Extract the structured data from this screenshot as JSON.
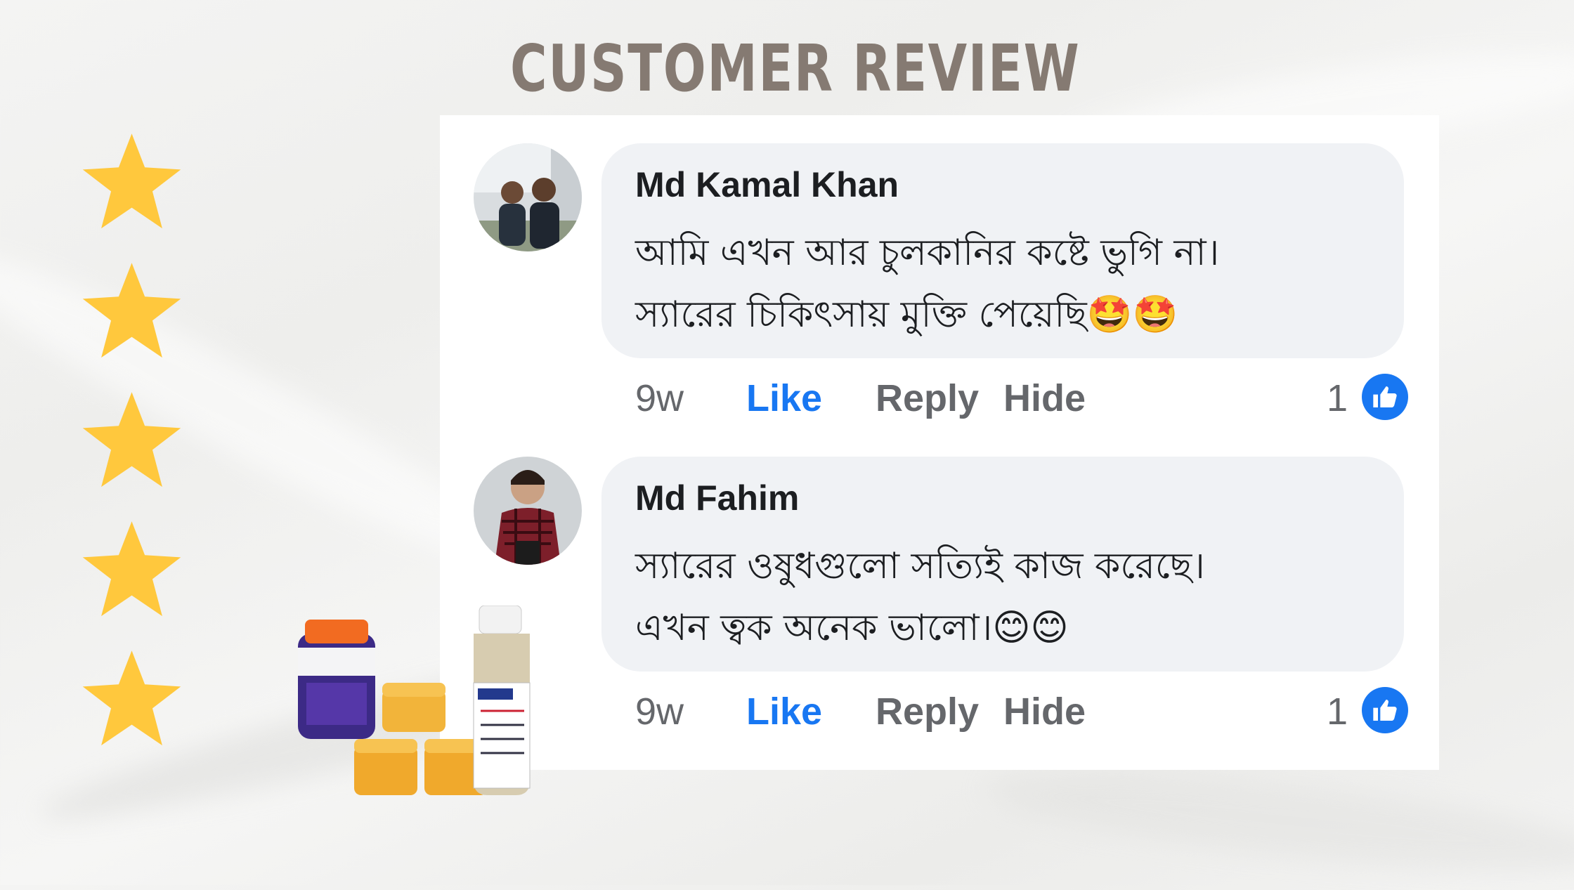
{
  "page": {
    "title": "CUSTOMER REVIEW",
    "rating_stars": 5,
    "star_color": "#ffc83d"
  },
  "comments": [
    {
      "author": "Md Kamal Khan",
      "text_line1": "আমি এখন আর চুলকানির কষ্টে ভুগি না।",
      "text_line2": "স্যারের চিকিৎসায় মুক্তি পেয়েছি",
      "emoji": "🤩🤩",
      "time": "9w",
      "like_label": "Like",
      "reply_label": "Reply",
      "hide_label": "Hide",
      "reaction_count": "1",
      "avatar_icon": "avatar-two-men-icon"
    },
    {
      "author": "Md Fahim",
      "text_line1": "স্যারের ওষুধগুলো সত্যিই কাজ করেছে।",
      "text_line2": "এখন ত্বক অনেক ভালো।",
      "emoji": "😊😊",
      "time": "9w",
      "like_label": "Like",
      "reply_label": "Reply",
      "hide_label": "Hide",
      "reaction_count": "1",
      "avatar_icon": "avatar-man-checked-shirt-icon"
    }
  ],
  "colors": {
    "like_blue": "#1877f2",
    "bubble_bg": "#f0f2f5",
    "title_color": "#857a72"
  }
}
